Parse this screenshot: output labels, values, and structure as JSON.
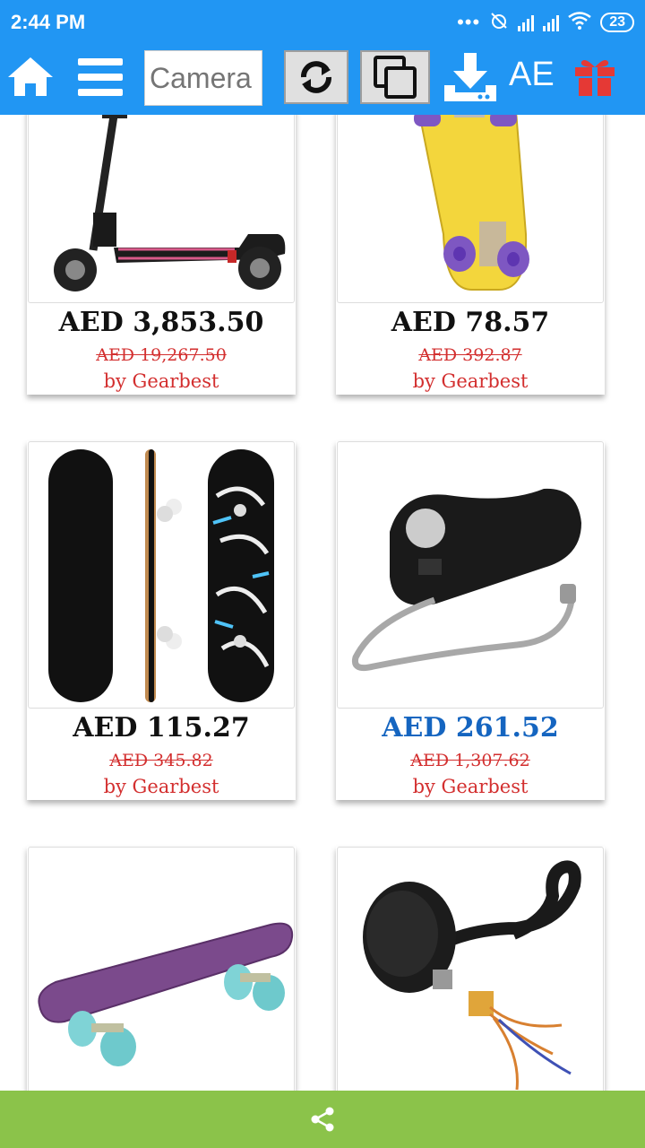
{
  "status_bar": {
    "time": "2:44 PM",
    "more_dots": "•••",
    "battery": "23"
  },
  "toolbar": {
    "search_placeholder": "Camera",
    "country": "AE",
    "icons": [
      "home-icon",
      "menu-icon",
      "refresh-icon",
      "copy-icon",
      "download-icon",
      "gift-icon"
    ]
  },
  "products": [
    {
      "price": "AED 3,853.50",
      "old_price": "AED 19,267.50",
      "seller": "by Gearbest",
      "image": "electric-scooter"
    },
    {
      "price": "AED 78.57",
      "old_price": "AED 392.87",
      "seller": "by Gearbest",
      "image": "yellow-penny-board"
    },
    {
      "price": "AED 115.27",
      "old_price": "AED 345.82",
      "seller": "by Gearbest",
      "image": "skateboard-deck-set"
    },
    {
      "price": "AED 261.52",
      "old_price": "AED 1,307.62",
      "seller": "by Gearbest",
      "image": "skateboard-remote"
    },
    {
      "image": "purple-penny-board"
    },
    {
      "image": "hub-motor"
    }
  ],
  "bottom_bar": {
    "icon": "share-icon"
  },
  "colors": {
    "app_bar": "#2196F3",
    "bottom_bar": "#8BC34A",
    "price_highlight": "#1565C0",
    "seller_red": "#D32F2F",
    "gift_red": "#E53935"
  }
}
